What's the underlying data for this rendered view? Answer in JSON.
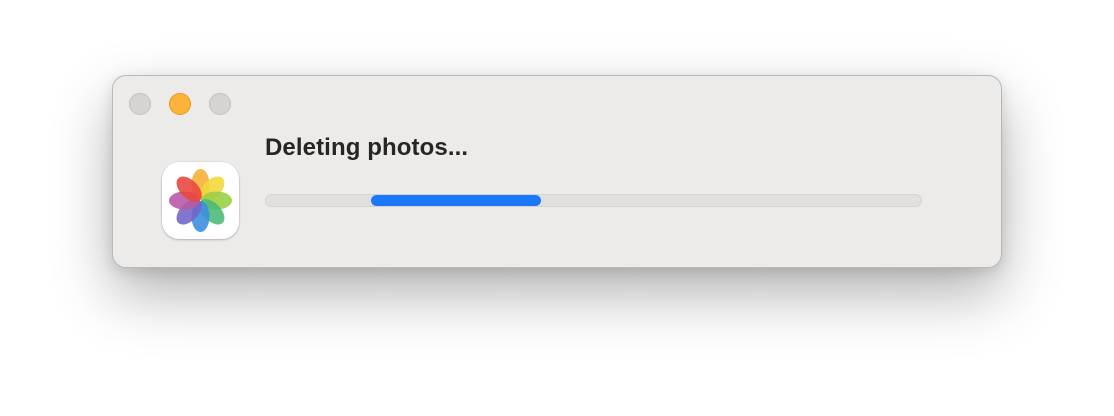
{
  "dialog": {
    "title": "Deleting photos...",
    "app_icon": "photos-app-icon",
    "controls": {
      "close": "window-close-button",
      "minimize": "window-minimize-button",
      "zoom": "window-zoom-button"
    },
    "progress": {
      "mode": "indeterminate",
      "segment_start": 0.16,
      "segment_end": 0.42,
      "color": "#1b78f6"
    }
  }
}
